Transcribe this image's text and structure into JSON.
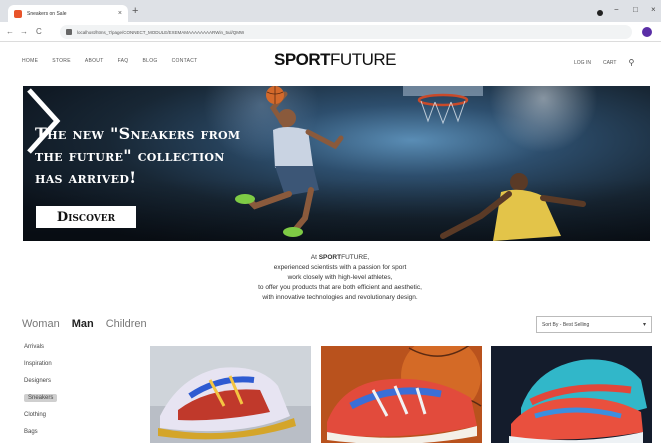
{
  "browser": {
    "tab_title": "Sneakers on Sale",
    "tab_close": "×",
    "new_tab": "+",
    "back": "←",
    "forward": "→",
    "reload": "C",
    "url": "localhost/htms_7/page/CONNECT_MODULE/EXEMAMAAAAAAAARWin_5ul/QMW",
    "minimize": "−",
    "maximize": "□",
    "close": "×"
  },
  "header": {
    "nav_left": [
      "HOME",
      "STORE",
      "ABOUT",
      "FAQ",
      "BLOG",
      "CONTACT"
    ],
    "logo_bold": "SPORT",
    "logo_thin": "FUTURE",
    "login": "LOG IN",
    "cart": "CART",
    "search_glyph": "⚲"
  },
  "hero": {
    "title_line1": "The new \"Sneakers from",
    "title_line2": "the future\" collection",
    "title_line3": "has arrived!",
    "button_label": "Discover"
  },
  "intro": {
    "prefix": "At ",
    "brand_bold": "SPORT",
    "brand_thin": "FUTURE",
    "suffix": ",",
    "line2": "experienced scientists with a passion for sport",
    "line3": "work closely with high-level athletes,",
    "line4": "to offer you products that are both efficient and aesthetic,",
    "line5": "with innovative technologies and revolutionary design."
  },
  "categories": {
    "woman": "Woman",
    "man": "Man",
    "children": "Children"
  },
  "sort": {
    "value": "Sort By - Best Selling",
    "arrow": "▾"
  },
  "filters": [
    "Arrivals",
    "Inspiration",
    "Designers",
    "Sneakers",
    "Clothing",
    "Bags"
  ],
  "colors": {
    "hero_dark": "#0c131c",
    "hero_mid": "#2d4e6d",
    "accent_jersey": "#f0d45a",
    "filter_selected": "#cfcfcf"
  }
}
